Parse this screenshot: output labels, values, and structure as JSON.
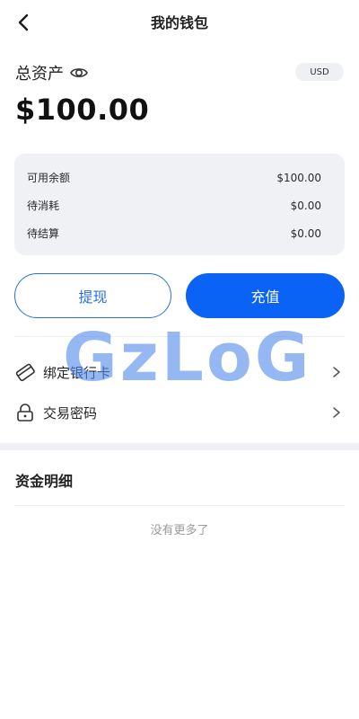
{
  "header": {
    "title": "我的钱包",
    "back_icon": "chevron-left-icon"
  },
  "assets": {
    "label": "总资产",
    "visibility_icon": "eye-icon",
    "currency": "USD",
    "total": "$100.00"
  },
  "balance": {
    "rows": [
      {
        "label": "可用余额",
        "value": "$100.00"
      },
      {
        "label": "待消耗",
        "value": "$0.00"
      },
      {
        "label": "待结算",
        "value": "$0.00"
      }
    ]
  },
  "actions": {
    "withdraw_label": "提现",
    "recharge_label": "充值",
    "primary_color": "#0b63f6"
  },
  "menu": {
    "items": [
      {
        "label": "绑定银行卡",
        "icon": "bank-card-icon"
      },
      {
        "label": "交易密码",
        "icon": "lock-icon"
      }
    ]
  },
  "details": {
    "title": "资金明细",
    "empty_text": "没有更多了"
  },
  "watermark": {
    "text": "GzLoG"
  }
}
